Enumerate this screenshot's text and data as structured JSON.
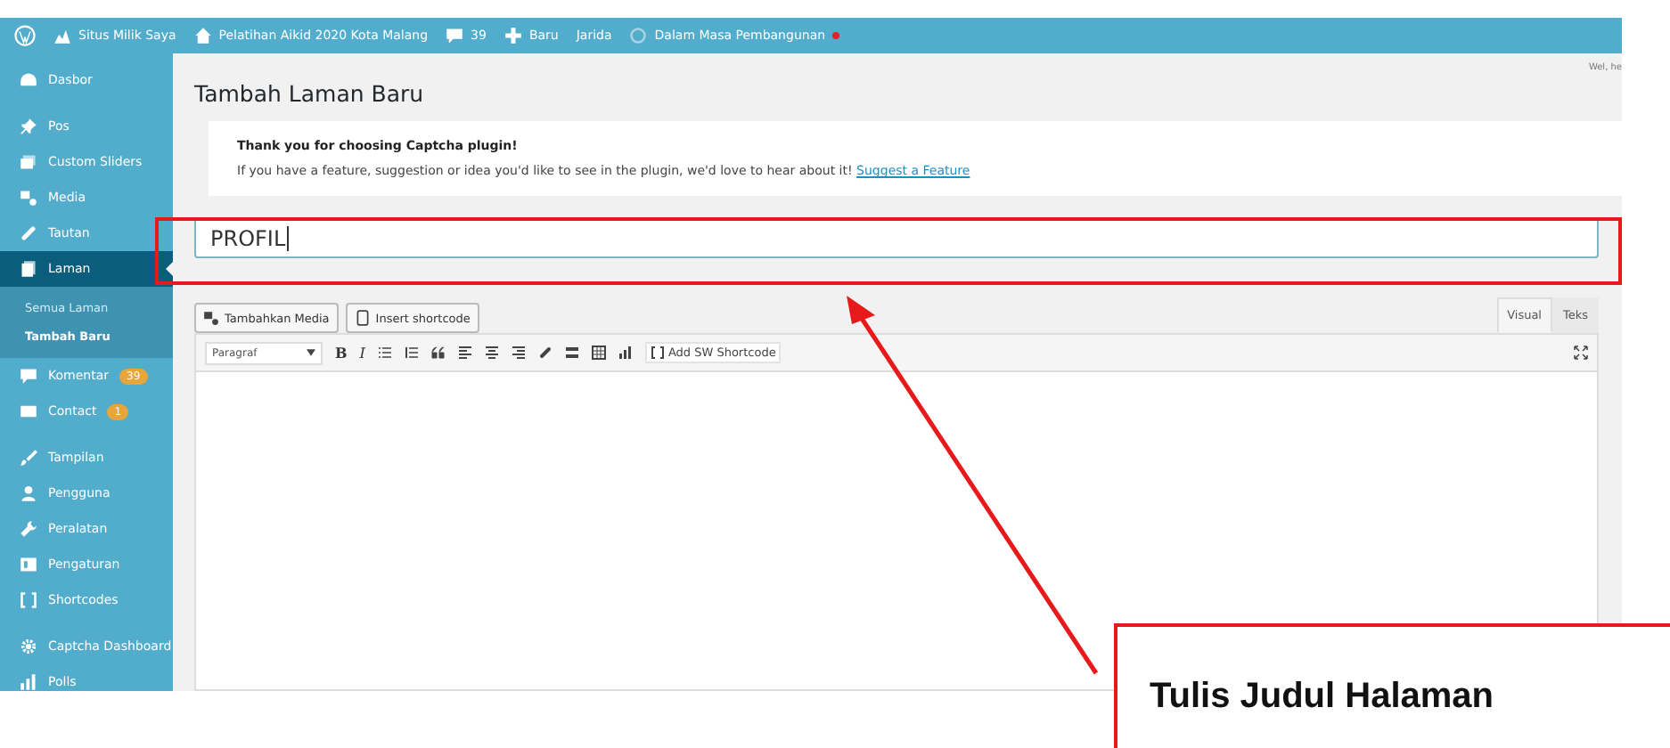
{
  "admin_bar": {
    "site": "Situs Milik Saya",
    "site_title": "Pelatihan Aikid 2020 Kota Malang",
    "comments": "39",
    "new": "Baru",
    "user": "Jarida",
    "status": "Dalam Masa Pembangunan"
  },
  "sidebar": {
    "groups": [
      {
        "items": [
          {
            "label": "Dasbor",
            "selected": false
          }
        ]
      },
      {
        "items": [
          {
            "label": "Pos",
            "selected": false
          },
          {
            "label": "Custom Sliders",
            "selected": false
          },
          {
            "label": "Media",
            "selected": false
          },
          {
            "label": "Tautan",
            "selected": false
          },
          {
            "label": "Laman",
            "selected": true,
            "children": [
              {
                "label": "Semua Laman",
                "selected": false
              },
              {
                "label": "Tambah Baru",
                "selected": true
              }
            ]
          },
          {
            "label": "Komentar",
            "selected": false,
            "badge": "39"
          },
          {
            "label": "Contact",
            "selected": false,
            "badge": "1"
          }
        ]
      },
      {
        "items": [
          {
            "label": "Tampilan",
            "selected": false
          },
          {
            "label": "Pengguna",
            "selected": false
          },
          {
            "label": "Peralatan",
            "selected": false
          },
          {
            "label": "Pengaturan",
            "selected": false
          },
          {
            "label": "Shortcodes",
            "selected": false
          }
        ]
      },
      {
        "items": [
          {
            "label": "Captcha Dashboard",
            "selected": false
          },
          {
            "label": "Polls",
            "selected": false
          }
        ]
      }
    ]
  },
  "screen_options": "Wel, he",
  "page_title": "Tambah Laman Baru",
  "notice": {
    "title": "Thank you for choosing Captcha plugin!",
    "text": "If you have a feature, suggestion or idea you'd like to see in the plugin, we'd love to hear about it!",
    "link": "Suggest a Feature"
  },
  "title_field": {
    "value": "PROFIL"
  },
  "media_buttons": [
    "Tambahkan Media",
    "Insert shortcode"
  ],
  "editor_tabs": [
    {
      "label": "Visual",
      "selected": true
    },
    {
      "label": "Teks",
      "selected": false
    }
  ],
  "toolbar": {
    "format": "Paragraf",
    "bold": "B",
    "italic": "I",
    "shortcode": "Add SW Shortcode"
  },
  "callout": {
    "text": "Tulis Judul Halaman"
  }
}
